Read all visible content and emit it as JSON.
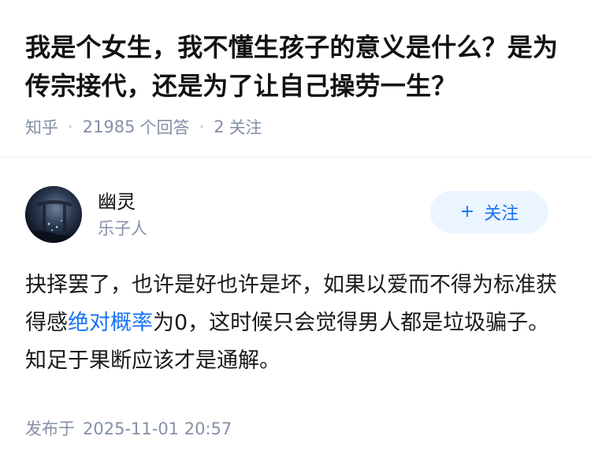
{
  "question": {
    "title": "我是个女生，我不懂生孩子的意义是什么？是为传宗接代，还是为了让自己操劳一生？",
    "source": "知乎",
    "answer_count": "21985",
    "answer_label": "个回答",
    "follower_count": "2",
    "follower_label": "关注"
  },
  "author": {
    "name": "幽灵",
    "bio": "乐子人",
    "avatar_icon": "avatar-image",
    "follow_button": {
      "icon": "+",
      "label": "关注"
    }
  },
  "answer": {
    "text_before": "抉择罢了，也许是好也许是坏，如果以爱而不得为标准获得感",
    "link_text": "绝对概率",
    "text_after": "为0，这时候只会觉得男人都是垃圾骗子。知足于果断应该才是通解。",
    "publish_label": "发布于",
    "publish_time": "2025-11-01 20:57"
  },
  "colors": {
    "accent": "#1772f6",
    "follow_bg": "#ebf5ff",
    "meta_text": "#8590a6"
  }
}
